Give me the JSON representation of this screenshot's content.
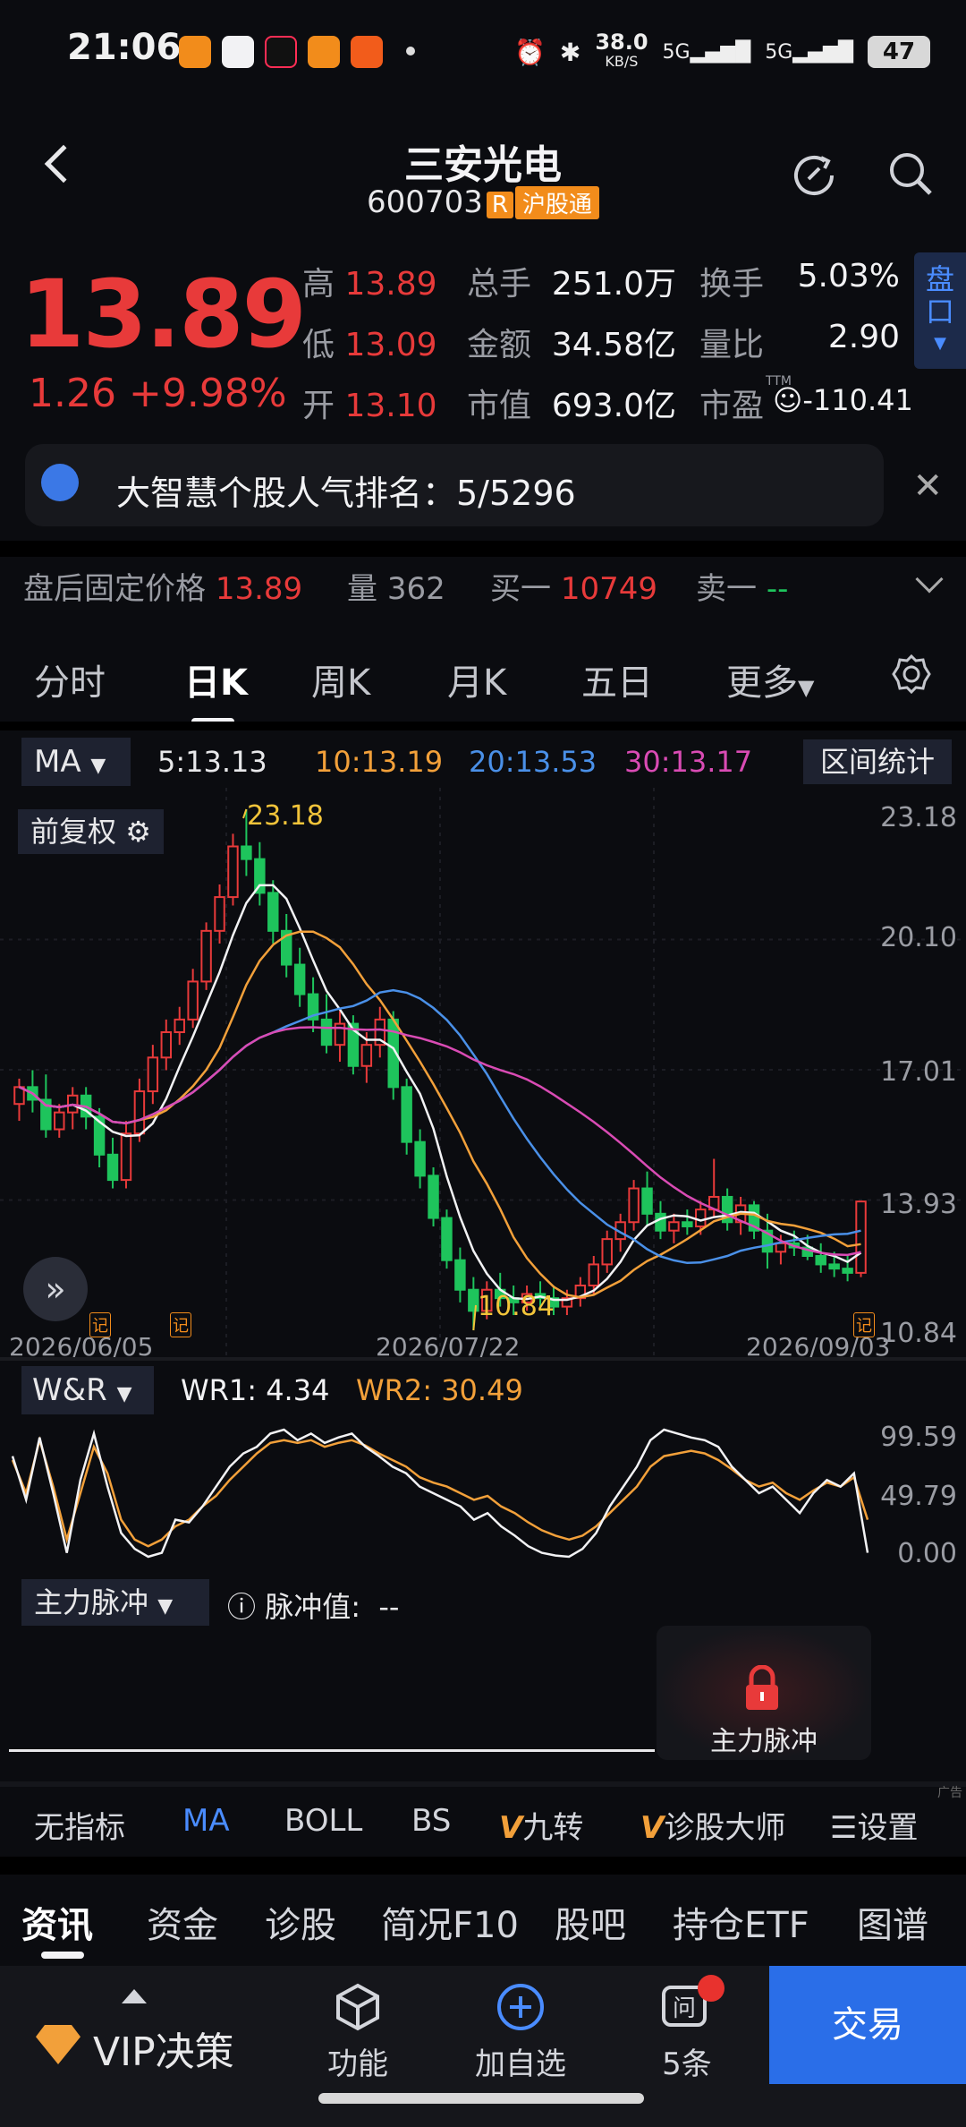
{
  "status_bar": {
    "time": "21:06",
    "net_speed": "38.0",
    "net_unit": "KB/S",
    "battery": "47",
    "icons": [
      "alarm-icon",
      "bluetooth-icon",
      "signal-5g-icon",
      "signal-icon"
    ]
  },
  "header": {
    "title": "三安光电",
    "code": "600703",
    "badge_r": "R",
    "badge_market": "沪股通"
  },
  "quote": {
    "price": "13.89",
    "change": "1.26",
    "change_pct": "+9.98%",
    "high_label": "高",
    "high": "13.89",
    "low_label": "低",
    "low": "13.09",
    "open_label": "开",
    "open": "13.10",
    "vol_label": "总手",
    "vol": "251.0万",
    "amount_label": "金额",
    "amount": "34.58亿",
    "mcap_label": "市值",
    "mcap": "693.0亿",
    "turnover_label": "换手",
    "turnover": "5.03%",
    "ratio_label": "量比",
    "ratio": "2.90",
    "pe_label": "市盈",
    "pe_sup": "TTM",
    "pe": "-110.41",
    "pankou": "盘口"
  },
  "banner": {
    "text": "大智慧个股人气排名：5/5296"
  },
  "after_hours": {
    "label": "盘后固定价格",
    "price": "13.89",
    "vol_label": "量",
    "vol": "362",
    "bid_label": "买一",
    "bid": "10749",
    "ask_label": "卖一",
    "ask": "--"
  },
  "tabs": [
    "分时",
    "日K",
    "周K",
    "月K",
    "五日",
    "更多"
  ],
  "ma": {
    "button": "MA",
    "items": [
      {
        "text": "5:13.13",
        "color": "#f2f2f4"
      },
      {
        "text": "10:13.19",
        "color": "#f2a03a"
      },
      {
        "text": "20:13.53",
        "color": "#4a90e8"
      },
      {
        "text": "30:13.17",
        "color": "#d94bb4"
      }
    ],
    "range_button": "区间统计",
    "adj_button": "前复权"
  },
  "chart_data": {
    "type": "candlestick",
    "y_ticks": [
      "23.18",
      "20.10",
      "17.01",
      "13.93",
      "10.84"
    ],
    "ylim": [
      10.84,
      23.18
    ],
    "x_labels": [
      "2026/06/05",
      "2026/07/22",
      "2026/09/03"
    ],
    "high_annotation": "23.18",
    "low_annotation": "10.84",
    "event_marker": "记",
    "candles": [
      [
        16.2,
        16.8,
        15.8,
        16.6
      ],
      [
        16.6,
        17.0,
        16.0,
        16.3
      ],
      [
        16.3,
        16.9,
        15.4,
        15.6
      ],
      [
        15.6,
        16.2,
        15.4,
        16.0
      ],
      [
        16.0,
        16.6,
        15.6,
        16.4
      ],
      [
        16.4,
        16.6,
        15.6,
        15.9
      ],
      [
        15.9,
        16.1,
        14.7,
        15.0
      ],
      [
        15.0,
        15.4,
        14.2,
        14.4
      ],
      [
        14.4,
        15.8,
        14.2,
        15.5
      ],
      [
        15.5,
        16.8,
        15.3,
        16.5
      ],
      [
        16.5,
        17.6,
        16.2,
        17.3
      ],
      [
        17.3,
        18.2,
        17.0,
        17.9
      ],
      [
        17.9,
        18.5,
        17.6,
        18.2
      ],
      [
        18.2,
        19.4,
        18.0,
        19.1
      ],
      [
        19.1,
        20.5,
        18.9,
        20.3
      ],
      [
        20.3,
        21.4,
        20.0,
        21.1
      ],
      [
        21.1,
        22.6,
        20.9,
        22.3
      ],
      [
        22.3,
        23.18,
        21.6,
        22.0
      ],
      [
        22.0,
        22.4,
        20.9,
        21.2
      ],
      [
        21.2,
        21.5,
        20.0,
        20.3
      ],
      [
        20.3,
        20.7,
        19.2,
        19.5
      ],
      [
        19.5,
        19.9,
        18.5,
        18.8
      ],
      [
        18.8,
        19.2,
        17.9,
        18.2
      ],
      [
        18.2,
        18.8,
        17.4,
        17.6
      ],
      [
        17.6,
        18.4,
        17.2,
        18.1
      ],
      [
        18.1,
        18.3,
        16.9,
        17.1
      ],
      [
        17.1,
        17.9,
        16.7,
        17.6
      ],
      [
        17.6,
        18.5,
        17.3,
        18.2
      ],
      [
        18.2,
        18.4,
        16.3,
        16.6
      ],
      [
        16.6,
        16.8,
        15.0,
        15.3
      ],
      [
        15.3,
        15.6,
        14.2,
        14.5
      ],
      [
        14.5,
        14.7,
        13.3,
        13.5
      ],
      [
        13.5,
        13.7,
        12.3,
        12.5
      ],
      [
        12.5,
        12.8,
        11.5,
        11.8
      ],
      [
        11.8,
        12.1,
        10.84,
        11.3
      ],
      [
        11.3,
        12.0,
        11.1,
        11.8
      ],
      [
        11.8,
        12.2,
        11.4,
        11.6
      ],
      [
        11.6,
        11.9,
        11.2,
        11.5
      ],
      [
        11.5,
        11.9,
        11.3,
        11.7
      ],
      [
        11.7,
        12.0,
        11.3,
        11.6
      ],
      [
        11.6,
        11.9,
        11.2,
        11.4
      ],
      [
        11.4,
        11.8,
        11.2,
        11.6
      ],
      [
        11.6,
        12.1,
        11.4,
        11.9
      ],
      [
        11.9,
        12.6,
        11.7,
        12.4
      ],
      [
        12.4,
        13.2,
        12.2,
        13.0
      ],
      [
        13.0,
        13.6,
        12.7,
        13.4
      ],
      [
        13.4,
        14.4,
        13.2,
        14.2
      ],
      [
        14.2,
        14.6,
        13.3,
        13.6
      ],
      [
        13.6,
        13.9,
        13.0,
        13.2
      ],
      [
        13.2,
        13.6,
        12.9,
        13.4
      ],
      [
        13.4,
        13.7,
        13.1,
        13.3
      ],
      [
        13.3,
        13.9,
        13.1,
        13.7
      ],
      [
        13.7,
        14.9,
        13.5,
        14.0
      ],
      [
        14.0,
        14.2,
        13.2,
        13.4
      ],
      [
        13.4,
        14.0,
        13.1,
        13.8
      ],
      [
        13.8,
        13.9,
        13.0,
        13.2
      ],
      [
        13.2,
        13.6,
        12.3,
        12.7
      ],
      [
        12.7,
        13.1,
        12.4,
        12.9
      ],
      [
        12.9,
        13.2,
        12.6,
        12.8
      ],
      [
        12.8,
        13.1,
        12.5,
        12.6
      ],
      [
        12.6,
        12.9,
        12.2,
        12.4
      ],
      [
        12.4,
        12.7,
        12.1,
        12.3
      ],
      [
        12.3,
        12.6,
        12.0,
        12.2
      ],
      [
        12.2,
        13.89,
        12.1,
        13.89
      ]
    ],
    "ma_series": [
      {
        "name": "5",
        "color": "#f2f2f4"
      },
      {
        "name": "10",
        "color": "#f2a03a"
      },
      {
        "name": "20",
        "color": "#4a90e8"
      },
      {
        "name": "30",
        "color": "#d94bb4"
      }
    ]
  },
  "wr": {
    "button": "W&R",
    "wr1_label": "WR1: 4.34",
    "wr2_label": "WR2: 30.49",
    "y_ticks": [
      "99.59",
      "49.79",
      "0.00"
    ],
    "wr1": [
      78,
      45,
      92,
      50,
      5,
      60,
      95,
      55,
      20,
      8,
      2,
      5,
      30,
      28,
      40,
      55,
      70,
      80,
      85,
      95,
      98,
      90,
      95,
      88,
      92,
      95,
      85,
      78,
      70,
      65,
      55,
      50,
      45,
      40,
      30,
      35,
      25,
      18,
      10,
      5,
      3,
      2,
      8,
      20,
      40,
      55,
      70,
      90,
      98,
      95,
      92,
      90,
      85,
      70,
      60,
      50,
      55,
      45,
      35,
      50,
      60,
      55,
      65,
      5
    ],
    "wr2": [
      75,
      50,
      90,
      55,
      15,
      50,
      85,
      65,
      30,
      15,
      10,
      15,
      25,
      30,
      40,
      48,
      60,
      70,
      80,
      88,
      90,
      88,
      90,
      85,
      88,
      90,
      86,
      80,
      75,
      70,
      62,
      58,
      55,
      50,
      45,
      48,
      40,
      35,
      28,
      22,
      18,
      15,
      18,
      25,
      35,
      45,
      55,
      70,
      78,
      80,
      82,
      80,
      75,
      68,
      60,
      55,
      58,
      50,
      45,
      52,
      58,
      55,
      62,
      30
    ]
  },
  "pulse": {
    "button": "主力脉冲",
    "value_label": "脉冲值:",
    "value": "--",
    "lock_label": "主力脉冲"
  },
  "indicators": [
    "无指标",
    "MA",
    "BOLL",
    "BS",
    "九转",
    "诊股大师",
    "设置"
  ],
  "ad_mark": "广告",
  "bottom_tabs": [
    "资讯",
    "资金",
    "诊股",
    "简况F10",
    "股吧",
    "持仓ETF",
    "图谱"
  ],
  "bottom_nav": {
    "vip": "VIP决策",
    "func": "功能",
    "add": "加自选",
    "ask": "5条",
    "trade": "交易"
  }
}
